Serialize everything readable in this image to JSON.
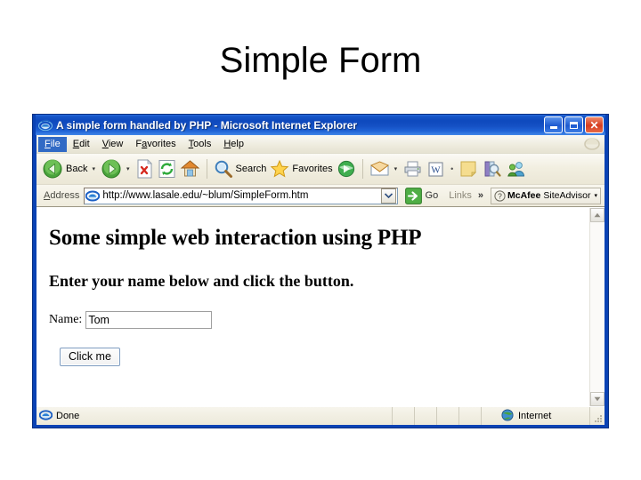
{
  "slide": {
    "title": "Simple Form"
  },
  "window": {
    "title": "A simple form handled by PHP - Microsoft Internet Explorer",
    "icon": "internet-explorer-icon",
    "controls": {
      "minimize": "Minimize",
      "maximize": "Maximize",
      "close": "Close"
    }
  },
  "menubar": {
    "items": [
      {
        "label": "File",
        "accel": "F",
        "selected": true
      },
      {
        "label": "Edit",
        "accel": "E",
        "selected": false
      },
      {
        "label": "View",
        "accel": "V",
        "selected": false
      },
      {
        "label": "Favorites",
        "accel": "a",
        "selected": false
      },
      {
        "label": "Tools",
        "accel": "T",
        "selected": false
      },
      {
        "label": "Help",
        "accel": "H",
        "selected": false
      }
    ]
  },
  "toolbar": {
    "back_label": "Back",
    "search_label": "Search",
    "favorites_label": "Favorites",
    "items": [
      {
        "name": "back-button",
        "icon": "back-arrow-icon",
        "label": "Back",
        "has_dropdown": true
      },
      {
        "name": "forward-button",
        "icon": "forward-arrow-icon",
        "label": "",
        "has_dropdown": true
      },
      {
        "name": "stop-button",
        "icon": "stop-icon",
        "label": ""
      },
      {
        "name": "refresh-button",
        "icon": "refresh-icon",
        "label": ""
      },
      {
        "name": "home-button",
        "icon": "home-icon",
        "label": ""
      },
      {
        "name": "search-button",
        "icon": "search-icon",
        "label": "Search"
      },
      {
        "name": "favorites-button",
        "icon": "star-icon",
        "label": "Favorites"
      },
      {
        "name": "media-button",
        "icon": "media-globe-icon",
        "label": ""
      },
      {
        "name": "mail-button",
        "icon": "mail-icon",
        "label": "",
        "has_dropdown": true
      },
      {
        "name": "print-button",
        "icon": "printer-icon",
        "label": ""
      },
      {
        "name": "edit-word-button",
        "icon": "word-document-icon",
        "label": ""
      },
      {
        "name": "notes-button",
        "icon": "sticky-note-icon",
        "label": ""
      },
      {
        "name": "research-button",
        "icon": "research-book-icon",
        "label": ""
      },
      {
        "name": "messenger-button",
        "icon": "messenger-people-icon",
        "label": ""
      }
    ]
  },
  "addressbar": {
    "label": "Address",
    "url": "http://www.lasale.edu/~blum/SimpleForm.htm",
    "placeholder": "http://",
    "icon": "page-globe-icon",
    "go_label": "Go",
    "links_label": "Links",
    "links_chevron": "»",
    "mcafee_name": "McAfee",
    "mcafee_sub": "SiteAdvisor",
    "mcafee_icon": "question-mark-icon"
  },
  "page": {
    "heading": "Some simple web interaction using PHP",
    "subheading": "Enter your name below and click the button.",
    "name_label": "Name:",
    "name_value": "Tom",
    "name_placeholder": "",
    "button_label": "Click me"
  },
  "scrollbar": {
    "up_glyph": "▲",
    "down_glyph": "▼"
  },
  "statusbar": {
    "status_text": "Done",
    "status_icon": "internet-explorer-icon",
    "zone_text": "Internet",
    "zone_icon": "globe-icon"
  },
  "colors": {
    "titlebar_blue": "#0A42B4",
    "menu_highlight": "#316AC5",
    "toolbar_cream": "#F1EFE2",
    "close_red": "#D53D20",
    "go_green": "#3FA23F"
  }
}
